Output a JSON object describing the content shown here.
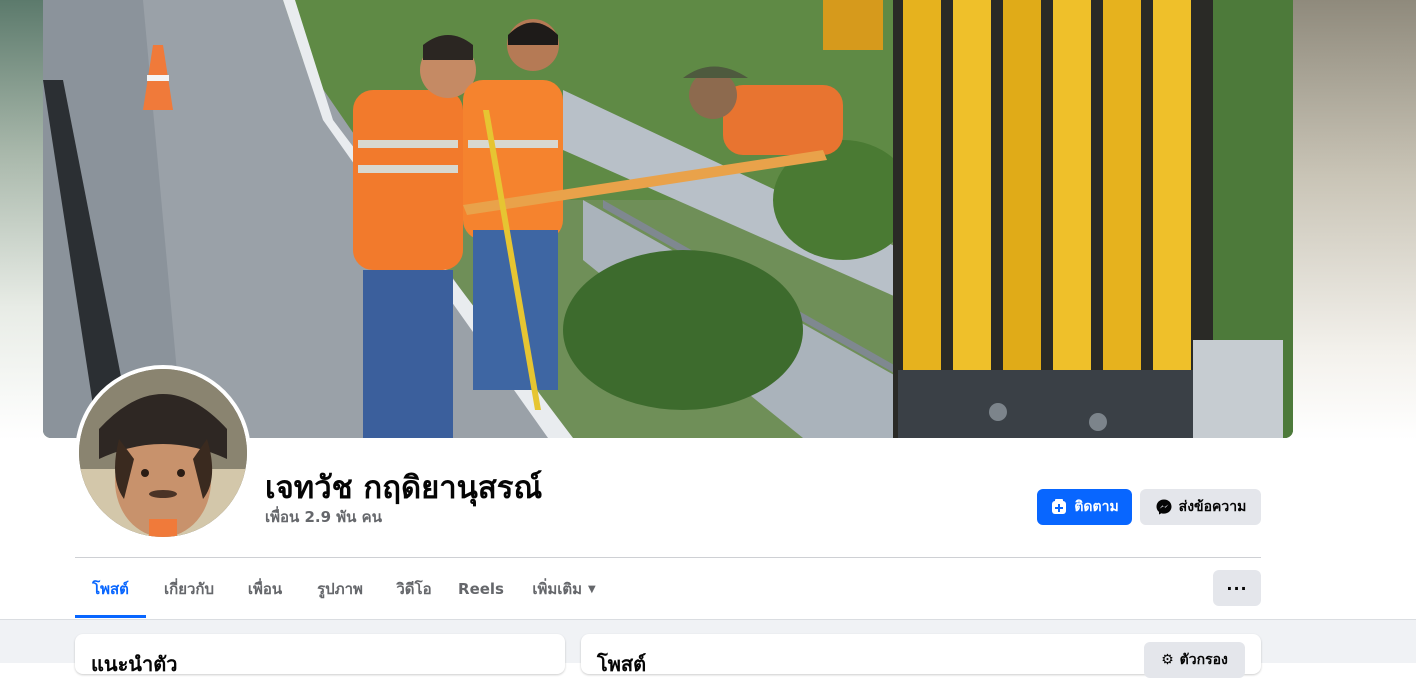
{
  "profile": {
    "name": "เจทวัช กฤดิยานุสรณ์",
    "friends_count": "เพื่อน 2.9 พัน คน"
  },
  "actions": {
    "follow_label": "ติดตาม",
    "message_label": "ส่งข้อความ",
    "more_label": "···"
  },
  "tabs": [
    {
      "label": "โพสต์",
      "active": true
    },
    {
      "label": "เกี่ยวกับ"
    },
    {
      "label": "เพื่อน"
    },
    {
      "label": "รูปภาพ"
    },
    {
      "label": "วิดีโอ"
    },
    {
      "label": "Reels"
    },
    {
      "label": "เพิ่มเติม"
    }
  ],
  "cards": {
    "intro_title": "แนะนำตัว",
    "posts_title": "โพสต์",
    "filter_label": "ตัวกรอง"
  },
  "colors": {
    "accent": "#0866ff",
    "secondary_button": "#e4e6eb",
    "feed_background": "#f0f2f5"
  },
  "icons": {
    "follow": "follow-plus-icon",
    "message": "messenger-icon",
    "more_caret": "caret-down-icon",
    "filter": "filter-sliders-icon"
  }
}
